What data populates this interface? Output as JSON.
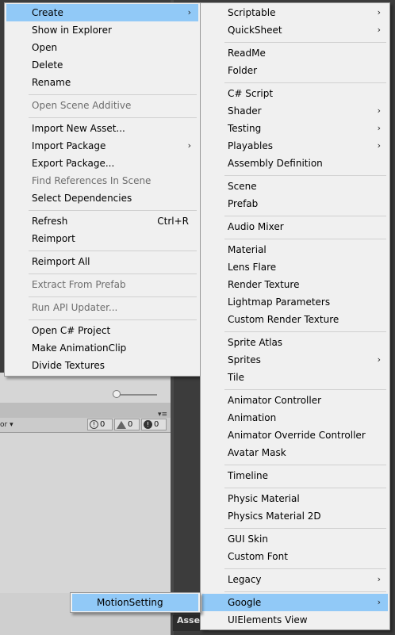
{
  "main_menu": {
    "items": [
      {
        "label": "Create",
        "arrow": "›",
        "highlighted": true
      },
      {
        "label": "Show in Explorer"
      },
      {
        "label": "Open"
      },
      {
        "label": "Delete"
      },
      {
        "label": "Rename"
      },
      {
        "label": "Open Scene Additive",
        "disabled": true
      },
      {
        "label": "Import New Asset..."
      },
      {
        "label": "Import Package",
        "arrow": "›"
      },
      {
        "label": "Export Package..."
      },
      {
        "label": "Find References In Scene",
        "disabled": true
      },
      {
        "label": "Select Dependencies"
      },
      {
        "label": "Refresh",
        "shortcut": "Ctrl+R"
      },
      {
        "label": "Reimport"
      },
      {
        "label": "Reimport All"
      },
      {
        "label": "Extract From Prefab",
        "disabled": true
      },
      {
        "label": "Run API Updater...",
        "disabled": true
      },
      {
        "label": "Open C# Project"
      },
      {
        "label": "Make AnimationClip"
      },
      {
        "label": "Divide Textures"
      }
    ]
  },
  "create_menu": {
    "items": [
      {
        "label": "Scriptable",
        "arrow": "›"
      },
      {
        "label": "QuickSheet",
        "arrow": "›"
      },
      {
        "label": "ReadMe"
      },
      {
        "label": "Folder"
      },
      {
        "label": "C# Script"
      },
      {
        "label": "Shader",
        "arrow": "›"
      },
      {
        "label": "Testing",
        "arrow": "›"
      },
      {
        "label": "Playables",
        "arrow": "›"
      },
      {
        "label": "Assembly Definition"
      },
      {
        "label": "Scene"
      },
      {
        "label": "Prefab"
      },
      {
        "label": "Audio Mixer"
      },
      {
        "label": "Material"
      },
      {
        "label": "Lens Flare"
      },
      {
        "label": "Render Texture"
      },
      {
        "label": "Lightmap Parameters"
      },
      {
        "label": "Custom Render Texture"
      },
      {
        "label": "Sprite Atlas"
      },
      {
        "label": "Sprites",
        "arrow": "›"
      },
      {
        "label": "Tile"
      },
      {
        "label": "Animator Controller"
      },
      {
        "label": "Animation"
      },
      {
        "label": "Animator Override Controller"
      },
      {
        "label": "Avatar Mask"
      },
      {
        "label": "Timeline"
      },
      {
        "label": "Physic Material"
      },
      {
        "label": "Physics Material 2D"
      },
      {
        "label": "GUI Skin"
      },
      {
        "label": "Custom Font"
      },
      {
        "label": "Legacy",
        "arrow": "›"
      },
      {
        "label": "Google",
        "arrow": "›",
        "highlighted": true
      },
      {
        "label": "UIElements View"
      }
    ]
  },
  "google_menu": {
    "items": [
      {
        "label": "MotionSetting",
        "highlighted": true
      }
    ]
  },
  "console_bar": {
    "dropdown_text": "or ▾",
    "info_count": "0",
    "warning_count": "0",
    "error_count": "0"
  },
  "assets_tab_label": "Asse",
  "colors": {
    "menu_bg": "#f0f0f0",
    "highlight": "#91c9f7",
    "disabled_text": "#6d6d6d"
  }
}
